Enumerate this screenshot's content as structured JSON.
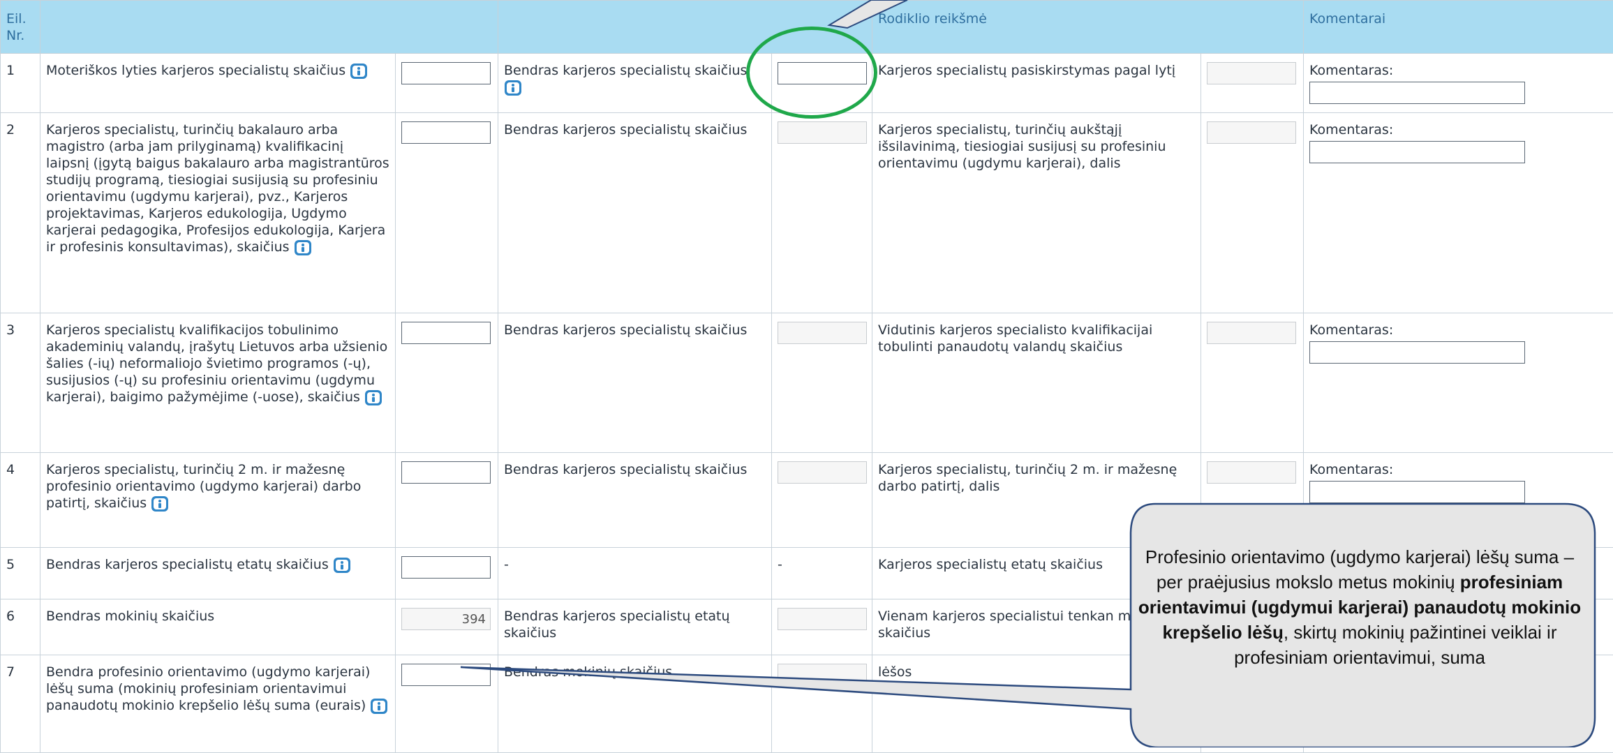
{
  "header": {
    "nr": "Eil. Nr.",
    "col3": "",
    "indicator_value": "Rodiklio reikšmė",
    "comments": "Komentarai"
  },
  "comment_label": "Komentaras:",
  "rows": [
    {
      "nr": "1",
      "description": "Moteriškos lyties karjeros specialistų skaičius",
      "input_value": "",
      "compare_label": "Bendras karjeros specialistų skaičius",
      "compare_value": "",
      "indicator": "Karjeros specialistų pasiskirstymas pagal lytį",
      "indicator_value": "",
      "comment_value": ""
    },
    {
      "nr": "2",
      "description": "Karjeros specialistų, turinčių bakalauro arba magistro (arba jam prilyginamą) kvalifikacinį laipsnį (įgytą baigus bakalauro arba magistrantūros studijų programą, tiesiogiai susijusią su profesiniu orientavimu (ugdymu karjerai), pvz., Karjeros projektavimas, Karjeros edukologija, Ugdymo karjerai pedagogika, Profesijos edukologija, Karjera ir profesinis konsultavimas), skaičius",
      "input_value": "",
      "compare_label": "Bendras karjeros specialistų skaičius",
      "compare_value": "",
      "indicator": "Karjeros specialistų, turinčių aukštąjį išsilavinimą, tiesiogiai susijusį su profesiniu orientavimu (ugdymu karjerai), dalis",
      "indicator_value": "",
      "comment_value": ""
    },
    {
      "nr": "3",
      "description": "Karjeros specialistų kvalifikacijos tobulinimo akademinių valandų, įrašytų Lietuvos arba užsienio šalies (-ių) neformaliojo švietimo programos (-ų), susijusios (-ų) su profesiniu orientavimu (ugdymu karjerai), baigimo pažymėjime (-uose), skaičius",
      "input_value": "",
      "compare_label": "Bendras karjeros specialistų skaičius",
      "compare_value": "",
      "indicator": "Vidutinis karjeros specialisto kvalifikacijai tobulinti panaudotų valandų skaičius",
      "indicator_value": "",
      "comment_value": ""
    },
    {
      "nr": "4",
      "description": "Karjeros specialistų, turinčių 2 m. ir mažesnę profesinio orientavimo (ugdymo karjerai) darbo patirtį, skaičius",
      "input_value": "",
      "compare_label": "Bendras karjeros specialistų skaičius",
      "compare_value": "",
      "indicator": "Karjeros specialistų, turinčių 2 m. ir mažesnę darbo patirtį, dalis",
      "indicator_value": "",
      "comment_value": ""
    },
    {
      "nr": "5",
      "description": "Bendras karjeros specialistų etatų skaičius",
      "input_value": "",
      "compare_label": "-",
      "compare_value": "-",
      "indicator": "Karjeros specialistų etatų skaičius",
      "indicator_value": "",
      "comment_value": ""
    },
    {
      "nr": "6",
      "description": "Bendras mokinių skaičius",
      "input_value": "394",
      "compare_label": "Bendras karjeros specialistų etatų skaičius",
      "compare_value": "",
      "indicator": "Vienam karjeros specialistui tenkan mokinių skaičius",
      "indicator_value": "",
      "comment_value": ""
    },
    {
      "nr": "7",
      "description": "Bendra profesinio orientavimo (ugdymo karjerai) lėšų suma (mokinių profesiniam orientavimui panaudotų mokinio krepšelio lėšų suma (eurais)",
      "input_value": "",
      "compare_label": "Bendras mokinių skaičius",
      "compare_value": "",
      "indicator": "lėšos",
      "indicator_value": "",
      "comment_value": ""
    }
  ],
  "callout": {
    "part1": "Profesinio orientavimo (ugdymo karjerai) lėšų suma – per praėjusius mokslo metus mokinių ",
    "bold": "profesiniam orientavimui (ugdymui karjerai) panaudotų mokinio krepšelio lėšų",
    "part2": ", skirtų mokinių pažintinei veiklai ir profesiniam orientavimui, suma"
  },
  "colors": {
    "header_bg": "#a9dcf2",
    "header_text": "#2f6f9f",
    "ellipse": "#1fa84a",
    "callout_fill": "#e6e6e6",
    "callout_border": "#2c4a7e",
    "info_icon": "#2f86c8"
  }
}
